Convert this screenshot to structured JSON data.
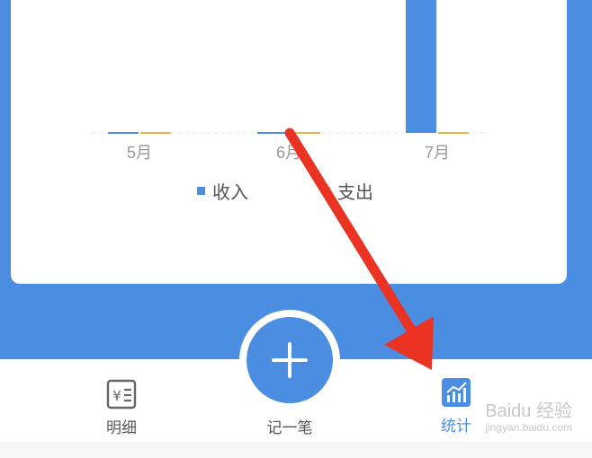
{
  "chart_data": {
    "type": "bar",
    "categories": [
      "5月",
      "6月",
      "7月"
    ],
    "series": [
      {
        "name": "收入",
        "values": [
          0,
          0,
          1
        ],
        "color": "#4b8ee1"
      },
      {
        "name": "支出",
        "values": [
          0,
          0,
          0
        ],
        "color": "#f0b04a"
      }
    ],
    "legend_position": "bottom"
  },
  "tabs": [
    {
      "label": "明细",
      "icon": "ledger-icon",
      "active": false
    },
    {
      "label": "记一笔",
      "icon": "plus-icon",
      "active": false
    },
    {
      "label": "统计",
      "icon": "chart-icon",
      "active": true
    }
  ],
  "watermark": {
    "brand": "Baidu 经验",
    "url": "jingyan.baidu.com"
  },
  "colors": {
    "primary": "#4b8ee1",
    "expense": "#f0b04a",
    "annotation_arrow": "#ea3322"
  }
}
